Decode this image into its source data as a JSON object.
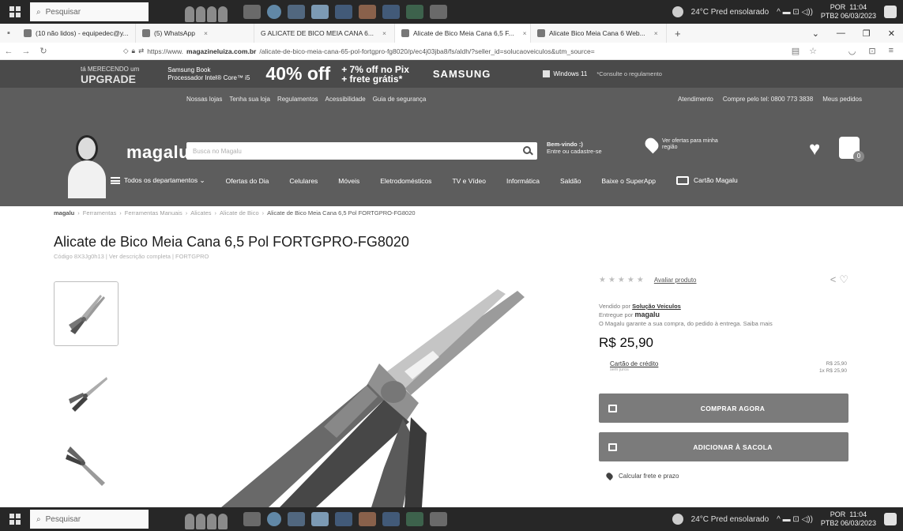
{
  "taskbar": {
    "search_placeholder": "Pesquisar",
    "weather": "24°C  Pred ensolarado",
    "clock_lang": "POR",
    "clock_kb": "PTB2",
    "clock_time": "11:04",
    "clock_date": "06/03/2023"
  },
  "browser": {
    "tabs": [
      {
        "label": "(10 não lidos) - equipedec@y...",
        "active": false
      },
      {
        "label": "(5) WhatsApp",
        "active": false
      },
      {
        "label": "G  ALICATE DE BICO MEIA CANA 6...",
        "active": false
      },
      {
        "label": "Alicate de Bico Meia Cana 6,5 F...",
        "active": true
      },
      {
        "label": "Alicate Bico Meia Cana 6 Web...",
        "active": false
      }
    ],
    "new_tab": "+",
    "url_prefix": "https://www.",
    "url_domain": "magazineluiza.com.br",
    "url_rest": "/alicate-de-bico-meia-cana-65-pol-fortgpro-fg8020/p/ec4j03jba8/fs/aldh/?seller_id=solucaoveiculos&utm_source="
  },
  "promo": {
    "upgrade_top": "tá MERECENDO um",
    "upgrade_main": "UPGRADE",
    "product_line1": "Samsung Book",
    "product_line2": "Processador Intel® Core™ i5",
    "discount": "40% off",
    "pix_line1": "+ 7% off no Pix",
    "pix_line2": "+ frete grátis*",
    "brand": "SAMSUNG",
    "windows": "Windows 11",
    "disclaimer": "*Consulte o regulamento"
  },
  "header": {
    "top_links_left": [
      "Nossas lojas",
      "Tenha sua loja",
      "Regulamentos",
      "Acessibilidade",
      "Guia de segurança"
    ],
    "top_links_right": [
      "Atendimento",
      "Compre pelo tel: 0800 773 3838",
      "Meus pedidos"
    ],
    "logo": "magalu",
    "search_placeholder": "Busca no Magalu",
    "welcome_line1": "Bem-vindo :)",
    "welcome_line2": "Entre ou cadastre-se",
    "location_line1": "Ver ofertas para minha",
    "location_line2": "região",
    "cart_count": "0",
    "menu": [
      "Todos os departamentos",
      "Ofertas do Dia",
      "Celulares",
      "Móveis",
      "Eletrodomésticos",
      "TV e Vídeo",
      "Informática",
      "Saldão",
      "Baixe o SuperApp",
      "Cartão Magalu"
    ]
  },
  "breadcrumb": {
    "home": "magalu",
    "items": [
      "Ferramentas",
      "Ferramentas Manuais",
      "Alicates",
      "Alicate de Bico"
    ],
    "current": "Alicate de Bico Meia Cana 6,5 Pol FORTGPRO-FG8020"
  },
  "product": {
    "title": "Alicate de Bico Meia Cana 6,5 Pol FORTGPRO-FG8020",
    "subtitle": "Código 8X3Jg0h13 | Ver descrição completa | FORTGPRO",
    "rate_label": "Avaliar produto",
    "sold_by_prefix": "Vendido por",
    "seller": "Solução Veiculos",
    "delivered_by_prefix": "Entregue por",
    "delivered_by": "magalu",
    "guarantee": "O Magalu garante a sua compra, do pedido à entrega. Saiba mais",
    "price": "R$ 25,90",
    "credit_label": "Cartão de crédito",
    "credit_sub": "sem juros",
    "credit_total": "R$ 25,90",
    "credit_installments": "1x R$ 25,90",
    "buy_now": "COMPRAR AGORA",
    "add_to_bag": "ADICIONAR À SACOLA",
    "shipping": "Calcular frete e prazo"
  }
}
